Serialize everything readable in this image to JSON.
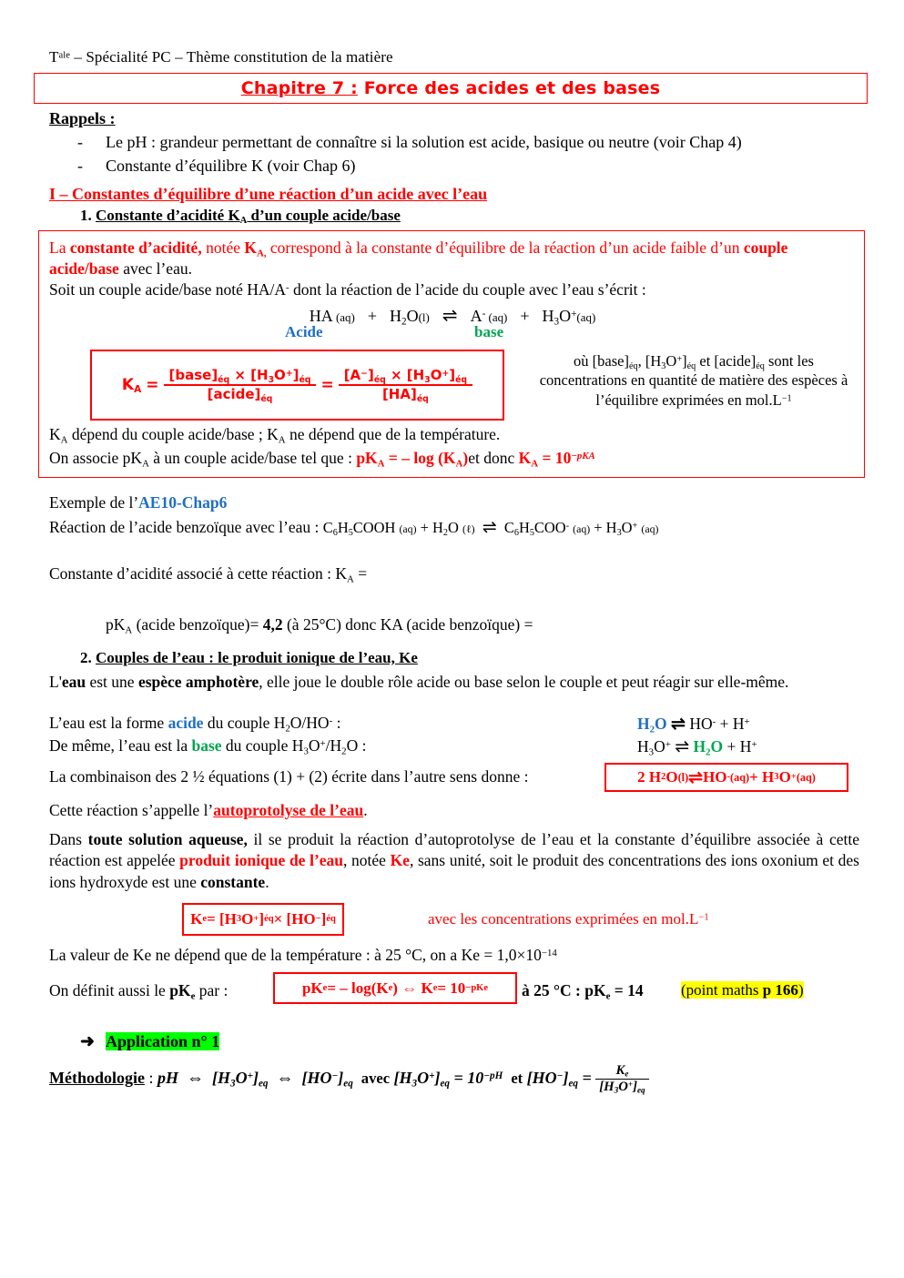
{
  "document": {
    "header": "Tale – Spécialité PC – Thème constitution de la matière",
    "header_sup": "ale",
    "header_prefix": "T",
    "header_rest": " – Spécialité PC – Thème constitution de la matière"
  },
  "title": {
    "chapter": "Chapitre 7 :",
    "rest": " Force des acides et des bases",
    "color": "#ff0000"
  },
  "rappels": {
    "heading": "Rappels :",
    "dash": "-",
    "items": [
      "Le pH : grandeur permettant de connaître si la solution est acide, basique ou neutre (voir Chap 4)",
      "Constante d’équilibre K (voir Chap 6)"
    ]
  },
  "section_1": {
    "heading": "I – Constantes d’équilibre d’une réaction d’un acide avec l’eau",
    "sub_1_number": "1.",
    "sub_1_label_a": "Constante d’acidité K",
    "sub_1_label_sub": "A",
    "sub_1_label_b": " d’un couple acide/base"
  },
  "definition_box": {
    "line1_part1": "La ",
    "line1_bold1": "constante d’acidité,",
    "line1_part2": " notée ",
    "line1_bold2_a": "K",
    "line1_bold2_sub": "A,",
    "line1_part3": " correspond à la constante d’équilibre de la réaction d’un acide faible d’un ",
    "line1_bold3": "couple acide/base",
    "line1_part4": " avec l’eau.",
    "line2_a": "Soit un couple acide/base noté HA/A",
    "line2_sup": "-",
    "line2_b": " dont la réaction de l’acide du couple avec l’eau s’écrit :",
    "equation": {
      "ha": "HA",
      "ha_state": "(aq)",
      "plus1": "+",
      "h2o": "H2O",
      "h2o_state": "(l)",
      "arrow": "⇌",
      "a_minus": "A",
      "a_sup": "-",
      "a_state": "(aq)",
      "plus2": "+",
      "h3o": "H3O",
      "h3o_sup": "+",
      "h3o_state": "(aq)"
    },
    "label_acide": "Acide",
    "label_base": "base",
    "label_acide_color": "#1f6fc4",
    "label_base_color": "#00a651",
    "ka_formula": {
      "lhs": "KA",
      "equals": "=",
      "frac1_num": "[base]éq × [H3O+]éq",
      "frac1_den": "[acide]éq",
      "equals2": "=",
      "frac2_num": "[A−]éq × [H3O+]éq",
      "frac2_den": "[HA]éq"
    },
    "ka_note": "où [base]éq, [H3O+]éq et [acide]éq sont les concentrations en quantité de matière des espèces à l’équilibre exprimées en mol.L−1",
    "line3": "KA dépend du couple acide/base ; KA ne dépend que de la température.",
    "line4_prefix": "On associe pKA à un couple acide/base tel que : ",
    "line4_formula1": "pKA = – log (KA)",
    "line4_mid": "et donc ",
    "line4_formula2": "KA = 10−pKA"
  },
  "example": {
    "title_prefix": "Exemple de l’",
    "title_link": "AE10-Chap6",
    "link_color": "#1f6fc4",
    "reaction_label": "Réaction de l’acide benzoïque avec l’eau : ",
    "reaction_eq": "C6H5COOH (aq) + H2O (ℓ)  ⇌  C6H5COO- (aq) + H3O+ (aq)",
    "ka_line": "Constante d’acidité associé à cette réaction : KA =",
    "pka_line_a": "pKA (acide benzoïque)",
    "pka_line_eq": "= ",
    "pka_value": "4,2",
    "pka_line_b": " (à 25°C)  donc KA (acide benzoïque) ="
  },
  "section_2": {
    "number": "2.",
    "label": "Couples de l’eau : le produit ionique de l’eau, Ke",
    "para_eau_a": "L'",
    "para_eau_b1": "eau",
    "para_eau_c": " est une ",
    "para_eau_b2": "espèce amphotère",
    "para_eau_d": ", elle joue le double rôle acide ou base selon le couple et peut réagir sur elle-même.",
    "line_acide_a": "L’eau est la forme ",
    "line_acide_kw": "acide",
    "line_acide_b": " du couple H2O/HO- :",
    "line_base_a": "De même, l’eau est la ",
    "line_base_kw": "base",
    "line_base_b": " du couple H3O+/H2O :",
    "eq_acide": "H2O ⇌ HO- + H+",
    "eq_base": "H3O+ ⇌ H2O + H+",
    "line_comb": "La combinaison des 2 ½ équations (1) + (2) écrite dans l’autre sens donne :",
    "comb_box": "2 H2O(l) ⇌ HO-(aq) + H3O+(aq)",
    "line_auto_a": "Cette réaction s’appelle l’",
    "line_auto_kw": "autoprotolyse de l’eau",
    "line_auto_b": ".",
    "para_aqueuse_a": "Dans ",
    "para_aqueuse_b1": "toute solution aqueuse,",
    "para_aqueuse_c": " il se produit la réaction d’autoprotolyse de l’eau et la constante d’équilibre associée à cette réaction est appelée ",
    "para_aqueuse_r1": "produit ionique de l’eau",
    "para_aqueuse_d": ", notée ",
    "para_aqueuse_r2": "Ke",
    "para_aqueuse_e": ", sans unité, soit le produit des concentrations des ions oxonium et des ions hydroxyde est une ",
    "para_aqueuse_b2": "constante",
    "para_aqueuse_f": ".",
    "ke_box": "Ke = [H3O+]éq × [HO−]éq",
    "ke_note": "avec les concentrations exprimées en mol.L−1",
    "ke_value_line": "La valeur de Ke ne dépend que de la température : à 25 °C, on a Ke = 1,0×10−14",
    "pke_prefix_a": "On définit aussi le ",
    "pke_prefix_b": "pKe",
    "pke_prefix_c": " par :",
    "pke_box": "pKe = – log(Ke) ⇔ Ke = 10−pKe",
    "pke_after": "à 25 °C : pKe = 14",
    "pke_maths_open": "(point maths ",
    "pke_maths_page": "p 166",
    "pke_maths_close": ")",
    "highlight_color": "#ffff00"
  },
  "application": {
    "arrow": "➜",
    "label": "Application n° 1",
    "highlight_color": "#00ff00",
    "methodo_label": "Méthodologie",
    "methodo_colon": " : ",
    "methodo_ph": "pH",
    "methodo_arrow1": "⇔",
    "methodo_h3o": "[H3O+]eq",
    "methodo_arrow2": "⇔",
    "methodo_ho": "[HO−]eq",
    "methodo_avec": "avec",
    "methodo_h3o2": "[H3O+]eq",
    "methodo_eq1": "= 10−pH",
    "methodo_et": "et",
    "methodo_ho2": "[HO−]eq",
    "methodo_eq2": "=",
    "methodo_frac_num": "Ke",
    "methodo_frac_den": "[H3O+]eq"
  }
}
